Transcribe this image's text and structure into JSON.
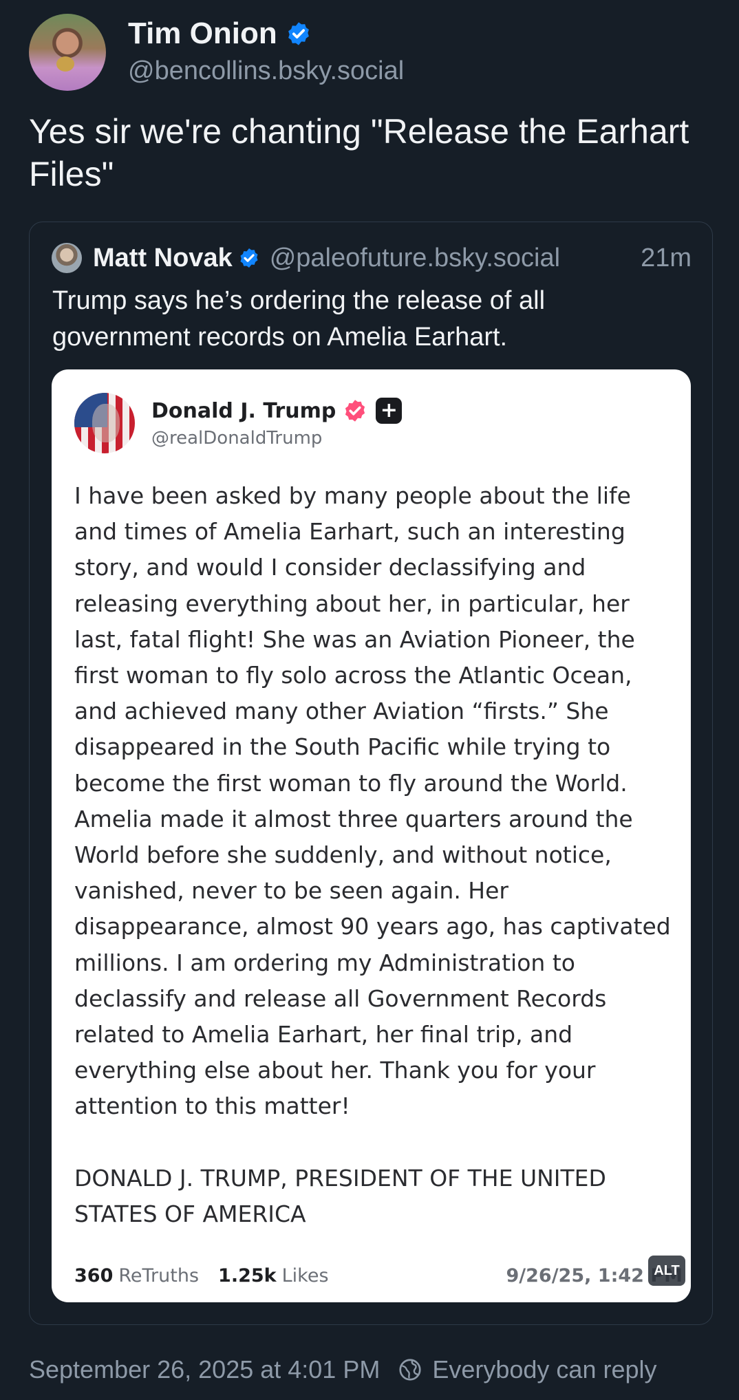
{
  "post": {
    "author_name": "Tim Onion",
    "author_handle": "@bencollins.bsky.social",
    "text": "Yes sir we're chanting \"Release the Earhart Files\"",
    "timestamp": "September 26, 2025 at 4:01 PM",
    "reply_setting": "Everybody can reply"
  },
  "quote": {
    "author_name": "Matt Novak",
    "author_handle": "@paleofuture.bsky.social",
    "time_ago": "21m",
    "text": "Trump says he’s ordering the release of all government records on Amelia Earhart."
  },
  "embed": {
    "name": "Donald J. Trump",
    "handle": "@realDonaldTrump",
    "body": "I have been asked by many people about the life and times of Amelia Earhart, such an interesting story, and would I consider declassifying and releasing everything about her, in particular, her last, fatal flight! She was an Aviation Pioneer, the first woman to fly solo across the Atlantic Ocean, and achieved many other Aviation “firsts.” She disappeared in the South Pacific while trying to become the first woman to fly around the World. Amelia made it almost three quarters around the World before she suddenly, and without notice, vanished, never to be seen again. Her disappearance, almost 90 years ago, has captivated millions. I am ordering my Administration to declassify and release all Government Records related to Amelia Earhart, her final trip, and everything else about her. Thank you for your attention to this matter!\n\nDONALD J. TRUMP, PRESIDENT OF THE UNITED STATES OF AMERICA",
    "retruths_count": "360",
    "retruths_label": "ReTruths",
    "likes_count": "1.25k",
    "likes_label": "Likes",
    "date": "9/26/25, 1:42 PM",
    "alt_label": "ALT"
  },
  "colors": {
    "background": "#161e27",
    "verified": "#1185fe",
    "secondary_text": "#8e9aa8",
    "truth_badge": "#ff4f7b"
  },
  "icons": {
    "verified": "verified-check-icon",
    "truth_verified": "truth-verified-badge-icon",
    "truth_plus": "truth-plus-icon",
    "reply_setting": "globe-icon"
  }
}
